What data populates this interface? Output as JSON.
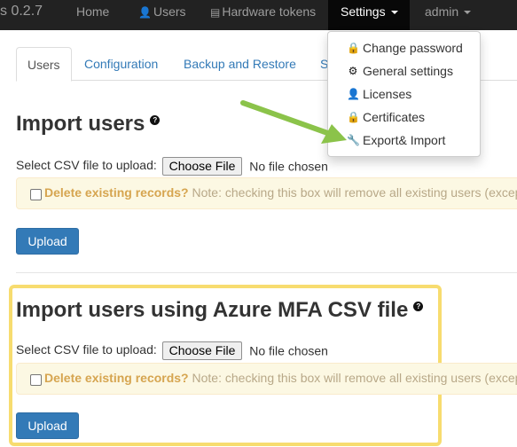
{
  "navbar": {
    "brand_partial": "s 0.2.7",
    "items": [
      {
        "label": "Home"
      },
      {
        "label": "Users",
        "icon": "user-icon"
      },
      {
        "label": "Hardware tokens",
        "icon": "hardware-token-icon"
      },
      {
        "label": "Settings"
      },
      {
        "label": "admin"
      }
    ]
  },
  "settings_menu": {
    "items": [
      {
        "label": "Change password",
        "icon": "lock-icon"
      },
      {
        "label": "General settings",
        "icon": "gear-icon"
      },
      {
        "label": "Licenses",
        "icon": "user-icon"
      },
      {
        "label": "Certificates",
        "icon": "lock-icon"
      },
      {
        "label": "Export& Import",
        "icon": "wrench-icon"
      }
    ]
  },
  "tabs": [
    {
      "label": "Users"
    },
    {
      "label": "Configuration"
    },
    {
      "label": "Backup and Restore"
    },
    {
      "label": "S"
    }
  ],
  "import_users": {
    "title": "Import users",
    "select_label": "Select CSV file to upload:",
    "choose_file": "Choose File",
    "no_file": "No file chosen",
    "delete_label": "Delete existing records?",
    "note": "Note: checking this box will remove all existing users (excep",
    "upload": "Upload"
  },
  "import_azure": {
    "title": "Import users using Azure MFA CSV file",
    "select_label": "Select CSV file to upload:",
    "choose_file": "Choose File",
    "no_file": "No file chosen",
    "delete_label": "Delete existing records?",
    "note": "Note: checking this box will remove all existing users (excep",
    "upload": "Upload"
  },
  "colors": {
    "navbar_bg": "#222222",
    "primary": "#337ab7",
    "highlight": "#f7dc6f",
    "arrow": "#8bc34a",
    "warning_bg": "#fcf8e3"
  }
}
